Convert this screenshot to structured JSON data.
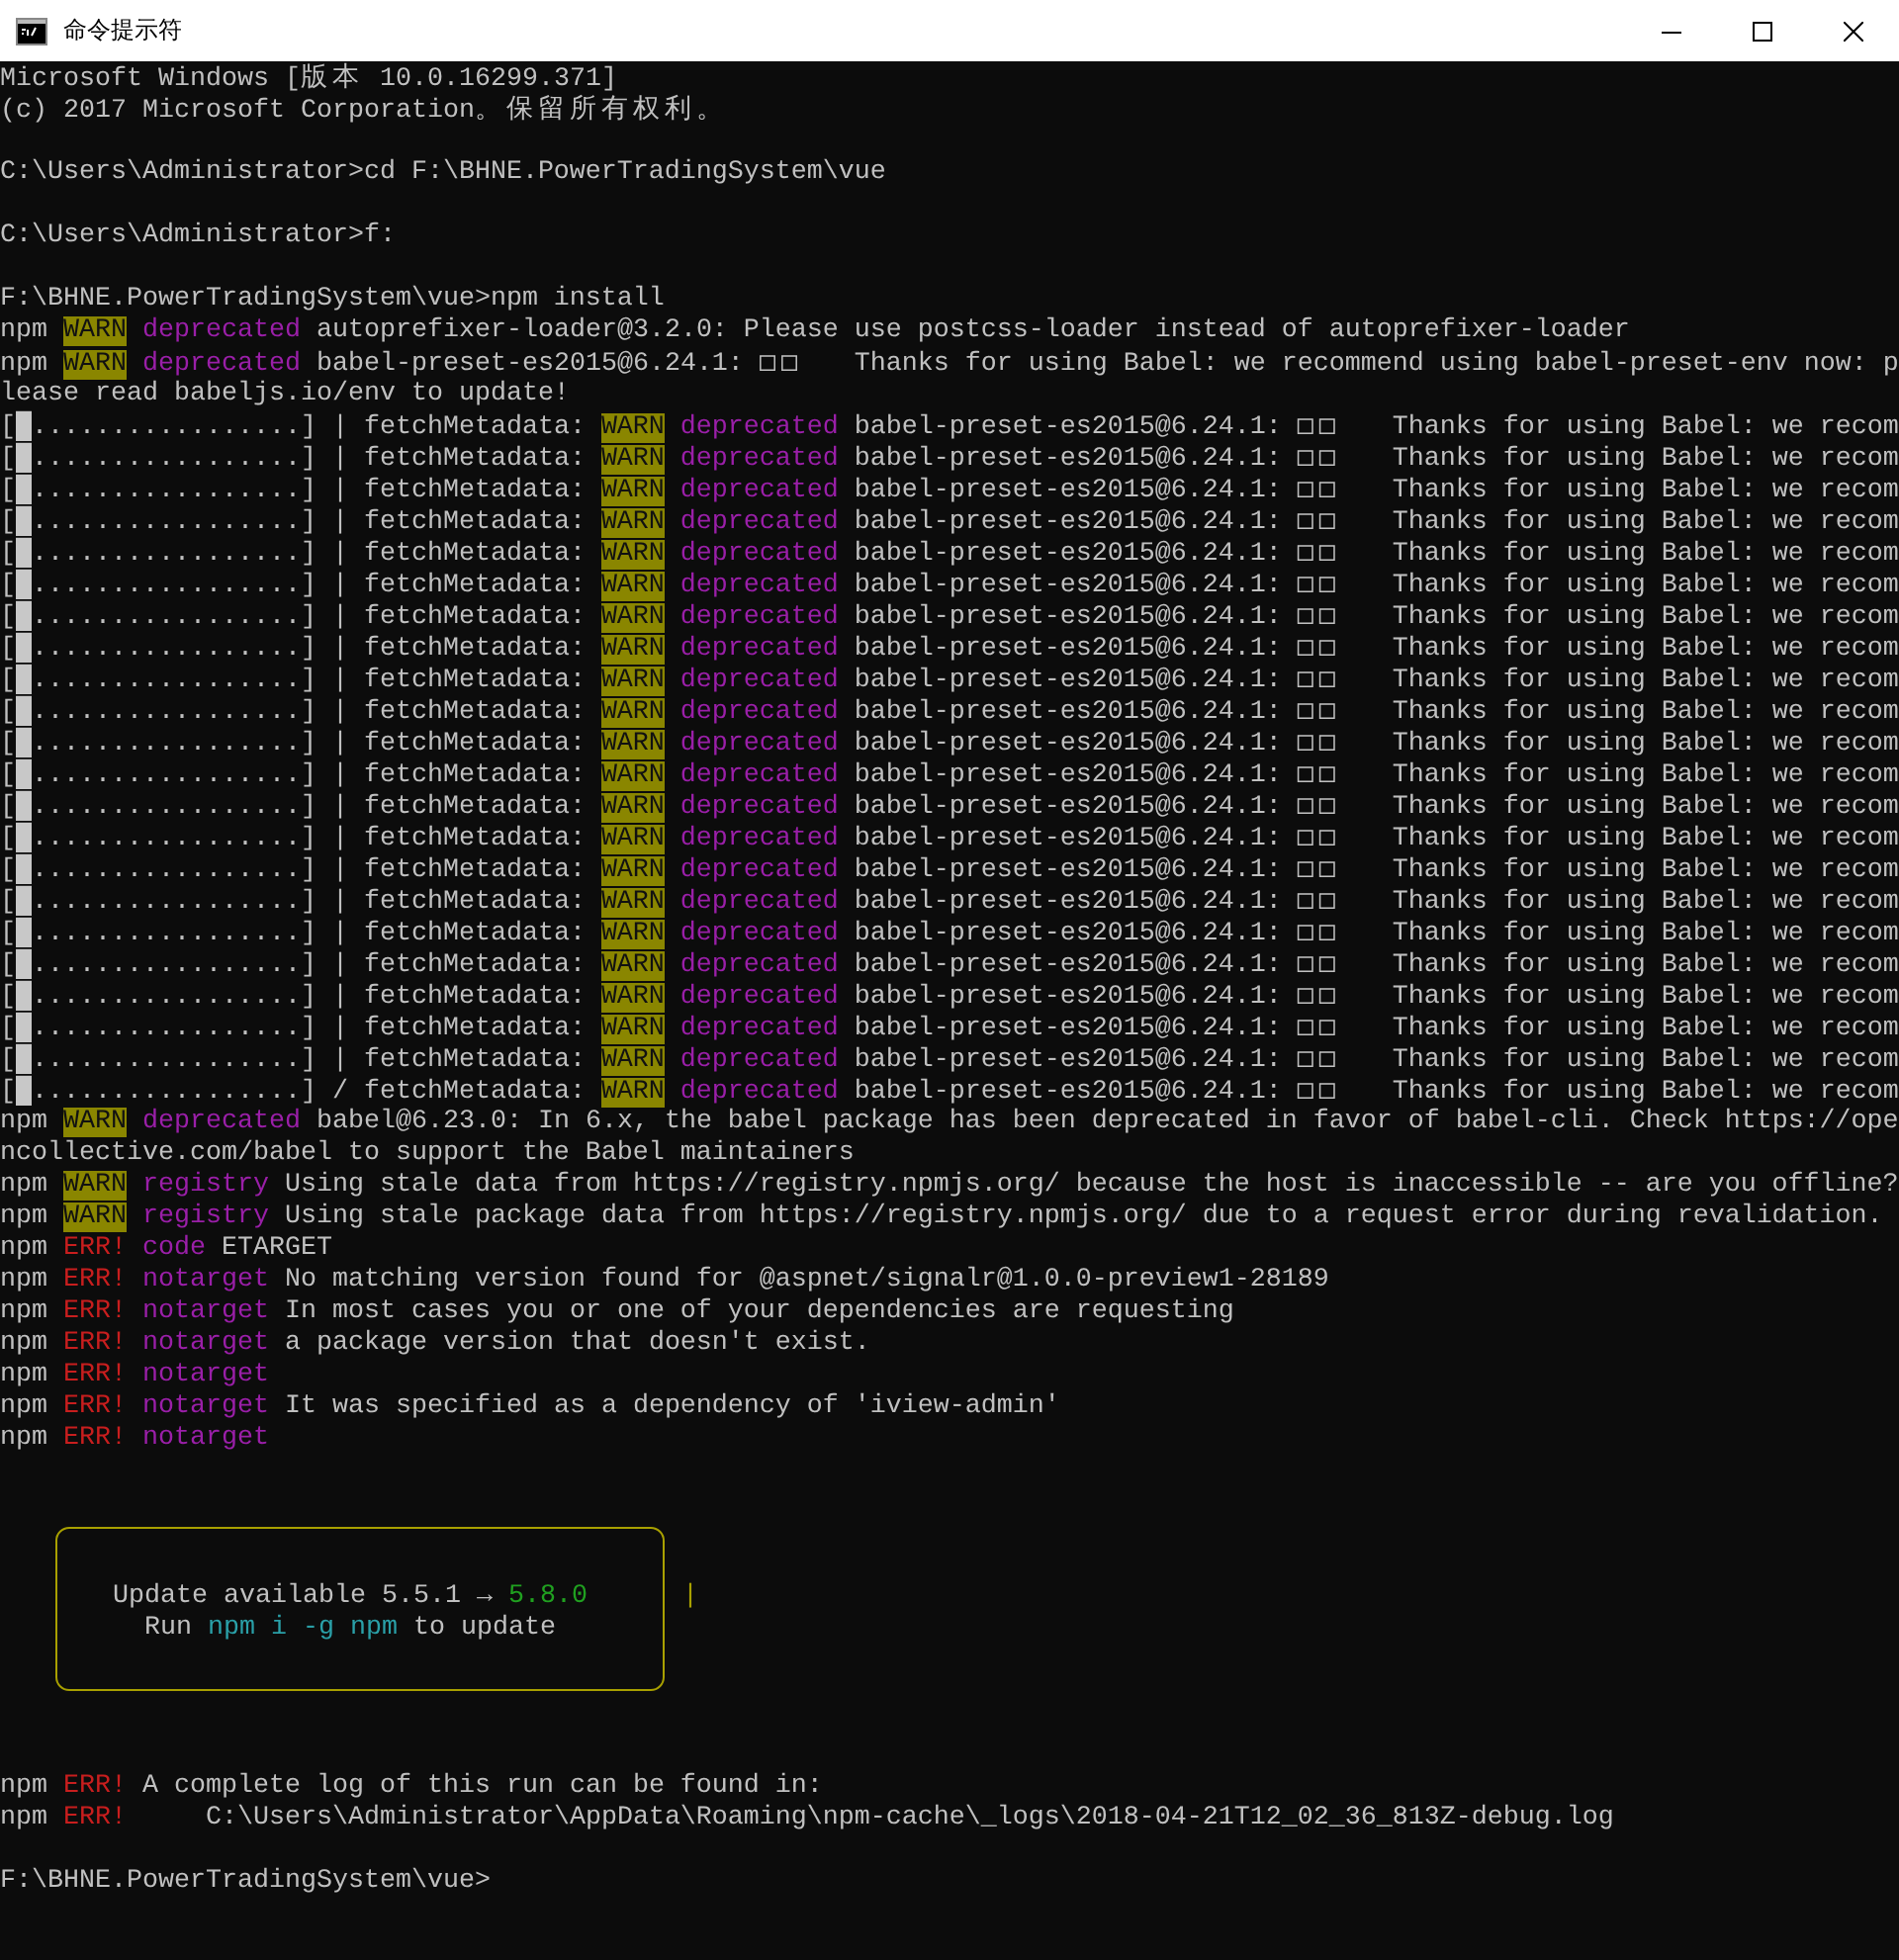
{
  "window": {
    "title": "命令提示符"
  },
  "console": {
    "lines": [
      {
        "kind": "text",
        "segments": [
          {
            "kind": "plain",
            "text": "Microsoft Windows ["
          },
          {
            "kind": "wide",
            "text": "版本"
          },
          {
            "kind": "plain",
            "text": " 10.0.16299.371]"
          }
        ]
      },
      {
        "kind": "text",
        "segments": [
          {
            "kind": "plain",
            "text": "(c) 2017 Microsoft Corporation"
          },
          {
            "kind": "wide",
            "text": "。保留所有权利。"
          }
        ]
      },
      {
        "kind": "blank"
      },
      {
        "kind": "text",
        "segments": [
          {
            "kind": "plain",
            "text": "C:\\Users\\Administrator>cd F:\\BHNE.PowerTradingSystem\\vue"
          }
        ]
      },
      {
        "kind": "blank"
      },
      {
        "kind": "text",
        "segments": [
          {
            "kind": "plain",
            "text": "C:\\Users\\Administrator>f:"
          }
        ]
      },
      {
        "kind": "blank"
      },
      {
        "kind": "text",
        "segments": [
          {
            "kind": "plain",
            "text": "F:\\BHNE.PowerTradingSystem\\vue>npm install"
          }
        ]
      },
      {
        "kind": "text",
        "segments": [
          {
            "kind": "plain",
            "text": "npm "
          },
          {
            "kind": "warn",
            "text": "WARN"
          },
          {
            "kind": "magenta",
            "text": " deprecated"
          },
          {
            "kind": "plain",
            "text": " autoprefixer-loader@3.2.0: Please use postcss-loader instead of autoprefixer-loader"
          }
        ]
      },
      {
        "kind": "text",
        "segments": [
          {
            "kind": "plain",
            "text": "npm "
          },
          {
            "kind": "warn",
            "text": "WARN"
          },
          {
            "kind": "magenta",
            "text": " deprecated"
          },
          {
            "kind": "plain",
            "text": " babel-preset-es2015@6.24.1: "
          },
          {
            "kind": "wide",
            "text": "□□"
          },
          {
            "kind": "plain",
            "text": "  Thanks for using Babel: we recommend using babel-preset-env now: p"
          }
        ]
      },
      {
        "kind": "text",
        "segments": [
          {
            "kind": "plain",
            "text": "lease read babeljs.io/env to update!"
          }
        ]
      },
      {
        "kind": "text",
        "segments": [
          {
            "kind": "plain",
            "text": "["
          },
          {
            "kind": "block",
            "text": "█"
          },
          {
            "kind": "plain",
            "text": ".................] | fetchMetadata: "
          },
          {
            "kind": "warn",
            "text": "WARN"
          },
          {
            "kind": "magenta",
            "text": " deprecated"
          },
          {
            "kind": "plain",
            "text": " babel-preset-es2015@6.24.1: "
          },
          {
            "kind": "wide",
            "text": "□□"
          },
          {
            "kind": "plain",
            "text": "  Thanks for using Babel: we recom"
          }
        ]
      },
      {
        "kind": "text",
        "segments": [
          {
            "kind": "plain",
            "text": "["
          },
          {
            "kind": "block",
            "text": "█"
          },
          {
            "kind": "plain",
            "text": ".................] | fetchMetadata: "
          },
          {
            "kind": "warn",
            "text": "WARN"
          },
          {
            "kind": "magenta",
            "text": " deprecated"
          },
          {
            "kind": "plain",
            "text": " babel-preset-es2015@6.24.1: "
          },
          {
            "kind": "wide",
            "text": "□□"
          },
          {
            "kind": "plain",
            "text": "  Thanks for using Babel: we recom"
          }
        ]
      },
      {
        "kind": "text",
        "segments": [
          {
            "kind": "plain",
            "text": "["
          },
          {
            "kind": "block",
            "text": "█"
          },
          {
            "kind": "plain",
            "text": ".................] | fetchMetadata: "
          },
          {
            "kind": "warn",
            "text": "WARN"
          },
          {
            "kind": "magenta",
            "text": " deprecated"
          },
          {
            "kind": "plain",
            "text": " babel-preset-es2015@6.24.1: "
          },
          {
            "kind": "wide",
            "text": "□□"
          },
          {
            "kind": "plain",
            "text": "  Thanks for using Babel: we recom"
          }
        ]
      },
      {
        "kind": "text",
        "segments": [
          {
            "kind": "plain",
            "text": "["
          },
          {
            "kind": "block",
            "text": "█"
          },
          {
            "kind": "plain",
            "text": ".................] | fetchMetadata: "
          },
          {
            "kind": "warn",
            "text": "WARN"
          },
          {
            "kind": "magenta",
            "text": " deprecated"
          },
          {
            "kind": "plain",
            "text": " babel-preset-es2015@6.24.1: "
          },
          {
            "kind": "wide",
            "text": "□□"
          },
          {
            "kind": "plain",
            "text": "  Thanks for using Babel: we recom"
          }
        ]
      },
      {
        "kind": "text",
        "segments": [
          {
            "kind": "plain",
            "text": "["
          },
          {
            "kind": "block",
            "text": "█"
          },
          {
            "kind": "plain",
            "text": ".................] | fetchMetadata: "
          },
          {
            "kind": "warn",
            "text": "WARN"
          },
          {
            "kind": "magenta",
            "text": " deprecated"
          },
          {
            "kind": "plain",
            "text": " babel-preset-es2015@6.24.1: "
          },
          {
            "kind": "wide",
            "text": "□□"
          },
          {
            "kind": "plain",
            "text": "  Thanks for using Babel: we recom"
          }
        ]
      },
      {
        "kind": "text",
        "segments": [
          {
            "kind": "plain",
            "text": "["
          },
          {
            "kind": "block",
            "text": "█"
          },
          {
            "kind": "plain",
            "text": ".................] | fetchMetadata: "
          },
          {
            "kind": "warn",
            "text": "WARN"
          },
          {
            "kind": "magenta",
            "text": " deprecated"
          },
          {
            "kind": "plain",
            "text": " babel-preset-es2015@6.24.1: "
          },
          {
            "kind": "wide",
            "text": "□□"
          },
          {
            "kind": "plain",
            "text": "  Thanks for using Babel: we recom"
          }
        ]
      },
      {
        "kind": "text",
        "segments": [
          {
            "kind": "plain",
            "text": "["
          },
          {
            "kind": "block",
            "text": "█"
          },
          {
            "kind": "plain",
            "text": ".................] | fetchMetadata: "
          },
          {
            "kind": "warn",
            "text": "WARN"
          },
          {
            "kind": "magenta",
            "text": " deprecated"
          },
          {
            "kind": "plain",
            "text": " babel-preset-es2015@6.24.1: "
          },
          {
            "kind": "wide",
            "text": "□□"
          },
          {
            "kind": "plain",
            "text": "  Thanks for using Babel: we recom"
          }
        ]
      },
      {
        "kind": "text",
        "segments": [
          {
            "kind": "plain",
            "text": "["
          },
          {
            "kind": "block",
            "text": "█"
          },
          {
            "kind": "plain",
            "text": ".................] | fetchMetadata: "
          },
          {
            "kind": "warn",
            "text": "WARN"
          },
          {
            "kind": "magenta",
            "text": " deprecated"
          },
          {
            "kind": "plain",
            "text": " babel-preset-es2015@6.24.1: "
          },
          {
            "kind": "wide",
            "text": "□□"
          },
          {
            "kind": "plain",
            "text": "  Thanks for using Babel: we recom"
          }
        ]
      },
      {
        "kind": "text",
        "segments": [
          {
            "kind": "plain",
            "text": "["
          },
          {
            "kind": "block",
            "text": "█"
          },
          {
            "kind": "plain",
            "text": ".................] | fetchMetadata: "
          },
          {
            "kind": "warn",
            "text": "WARN"
          },
          {
            "kind": "magenta",
            "text": " deprecated"
          },
          {
            "kind": "plain",
            "text": " babel-preset-es2015@6.24.1: "
          },
          {
            "kind": "wide",
            "text": "□□"
          },
          {
            "kind": "plain",
            "text": "  Thanks for using Babel: we recom"
          }
        ]
      },
      {
        "kind": "text",
        "segments": [
          {
            "kind": "plain",
            "text": "["
          },
          {
            "kind": "block",
            "text": "█"
          },
          {
            "kind": "plain",
            "text": ".................] | fetchMetadata: "
          },
          {
            "kind": "warn",
            "text": "WARN"
          },
          {
            "kind": "magenta",
            "text": " deprecated"
          },
          {
            "kind": "plain",
            "text": " babel-preset-es2015@6.24.1: "
          },
          {
            "kind": "wide",
            "text": "□□"
          },
          {
            "kind": "plain",
            "text": "  Thanks for using Babel: we recom"
          }
        ]
      },
      {
        "kind": "text",
        "segments": [
          {
            "kind": "plain",
            "text": "["
          },
          {
            "kind": "block",
            "text": "█"
          },
          {
            "kind": "plain",
            "text": ".................] | fetchMetadata: "
          },
          {
            "kind": "warn",
            "text": "WARN"
          },
          {
            "kind": "magenta",
            "text": " deprecated"
          },
          {
            "kind": "plain",
            "text": " babel-preset-es2015@6.24.1: "
          },
          {
            "kind": "wide",
            "text": "□□"
          },
          {
            "kind": "plain",
            "text": "  Thanks for using Babel: we recom"
          }
        ]
      },
      {
        "kind": "text",
        "segments": [
          {
            "kind": "plain",
            "text": "["
          },
          {
            "kind": "block",
            "text": "█"
          },
          {
            "kind": "plain",
            "text": ".................] | fetchMetadata: "
          },
          {
            "kind": "warn",
            "text": "WARN"
          },
          {
            "kind": "magenta",
            "text": " deprecated"
          },
          {
            "kind": "plain",
            "text": " babel-preset-es2015@6.24.1: "
          },
          {
            "kind": "wide",
            "text": "□□"
          },
          {
            "kind": "plain",
            "text": "  Thanks for using Babel: we recom"
          }
        ]
      },
      {
        "kind": "text",
        "segments": [
          {
            "kind": "plain",
            "text": "["
          },
          {
            "kind": "block",
            "text": "█"
          },
          {
            "kind": "plain",
            "text": ".................] | fetchMetadata: "
          },
          {
            "kind": "warn",
            "text": "WARN"
          },
          {
            "kind": "magenta",
            "text": " deprecated"
          },
          {
            "kind": "plain",
            "text": " babel-preset-es2015@6.24.1: "
          },
          {
            "kind": "wide",
            "text": "□□"
          },
          {
            "kind": "plain",
            "text": "  Thanks for using Babel: we recom"
          }
        ]
      },
      {
        "kind": "text",
        "segments": [
          {
            "kind": "plain",
            "text": "["
          },
          {
            "kind": "block",
            "text": "█"
          },
          {
            "kind": "plain",
            "text": ".................] | fetchMetadata: "
          },
          {
            "kind": "warn",
            "text": "WARN"
          },
          {
            "kind": "magenta",
            "text": " deprecated"
          },
          {
            "kind": "plain",
            "text": " babel-preset-es2015@6.24.1: "
          },
          {
            "kind": "wide",
            "text": "□□"
          },
          {
            "kind": "plain",
            "text": "  Thanks for using Babel: we recom"
          }
        ]
      },
      {
        "kind": "text",
        "segments": [
          {
            "kind": "plain",
            "text": "["
          },
          {
            "kind": "block",
            "text": "█"
          },
          {
            "kind": "plain",
            "text": ".................] | fetchMetadata: "
          },
          {
            "kind": "warn",
            "text": "WARN"
          },
          {
            "kind": "magenta",
            "text": " deprecated"
          },
          {
            "kind": "plain",
            "text": " babel-preset-es2015@6.24.1: "
          },
          {
            "kind": "wide",
            "text": "□□"
          },
          {
            "kind": "plain",
            "text": "  Thanks for using Babel: we recom"
          }
        ]
      },
      {
        "kind": "text",
        "segments": [
          {
            "kind": "plain",
            "text": "["
          },
          {
            "kind": "block",
            "text": "█"
          },
          {
            "kind": "plain",
            "text": ".................] | fetchMetadata: "
          },
          {
            "kind": "warn",
            "text": "WARN"
          },
          {
            "kind": "magenta",
            "text": " deprecated"
          },
          {
            "kind": "plain",
            "text": " babel-preset-es2015@6.24.1: "
          },
          {
            "kind": "wide",
            "text": "□□"
          },
          {
            "kind": "plain",
            "text": "  Thanks for using Babel: we recom"
          }
        ]
      },
      {
        "kind": "text",
        "segments": [
          {
            "kind": "plain",
            "text": "["
          },
          {
            "kind": "block",
            "text": "█"
          },
          {
            "kind": "plain",
            "text": ".................] | fetchMetadata: "
          },
          {
            "kind": "warn",
            "text": "WARN"
          },
          {
            "kind": "magenta",
            "text": " deprecated"
          },
          {
            "kind": "plain",
            "text": " babel-preset-es2015@6.24.1: "
          },
          {
            "kind": "wide",
            "text": "□□"
          },
          {
            "kind": "plain",
            "text": "  Thanks for using Babel: we recom"
          }
        ]
      },
      {
        "kind": "text",
        "segments": [
          {
            "kind": "plain",
            "text": "["
          },
          {
            "kind": "block",
            "text": "█"
          },
          {
            "kind": "plain",
            "text": ".................] | fetchMetadata: "
          },
          {
            "kind": "warn",
            "text": "WARN"
          },
          {
            "kind": "magenta",
            "text": " deprecated"
          },
          {
            "kind": "plain",
            "text": " babel-preset-es2015@6.24.1: "
          },
          {
            "kind": "wide",
            "text": "□□"
          },
          {
            "kind": "plain",
            "text": "  Thanks for using Babel: we recom"
          }
        ]
      },
      {
        "kind": "text",
        "segments": [
          {
            "kind": "plain",
            "text": "["
          },
          {
            "kind": "block",
            "text": "█"
          },
          {
            "kind": "plain",
            "text": ".................] | fetchMetadata: "
          },
          {
            "kind": "warn",
            "text": "WARN"
          },
          {
            "kind": "magenta",
            "text": " deprecated"
          },
          {
            "kind": "plain",
            "text": " babel-preset-es2015@6.24.1: "
          },
          {
            "kind": "wide",
            "text": "□□"
          },
          {
            "kind": "plain",
            "text": "  Thanks for using Babel: we recom"
          }
        ]
      },
      {
        "kind": "text",
        "segments": [
          {
            "kind": "plain",
            "text": "["
          },
          {
            "kind": "block",
            "text": "█"
          },
          {
            "kind": "plain",
            "text": ".................] | fetchMetadata: "
          },
          {
            "kind": "warn",
            "text": "WARN"
          },
          {
            "kind": "magenta",
            "text": " deprecated"
          },
          {
            "kind": "plain",
            "text": " babel-preset-es2015@6.24.1: "
          },
          {
            "kind": "wide",
            "text": "□□"
          },
          {
            "kind": "plain",
            "text": "  Thanks for using Babel: we recom"
          }
        ]
      },
      {
        "kind": "text",
        "segments": [
          {
            "kind": "plain",
            "text": "["
          },
          {
            "kind": "block",
            "text": "█"
          },
          {
            "kind": "plain",
            "text": ".................] | fetchMetadata: "
          },
          {
            "kind": "warn",
            "text": "WARN"
          },
          {
            "kind": "magenta",
            "text": " deprecated"
          },
          {
            "kind": "plain",
            "text": " babel-preset-es2015@6.24.1: "
          },
          {
            "kind": "wide",
            "text": "□□"
          },
          {
            "kind": "plain",
            "text": "  Thanks for using Babel: we recom"
          }
        ]
      },
      {
        "kind": "text",
        "segments": [
          {
            "kind": "plain",
            "text": "["
          },
          {
            "kind": "block",
            "text": "█"
          },
          {
            "kind": "plain",
            "text": ".................] / fetchMetadata: "
          },
          {
            "kind": "warn",
            "text": "WARN"
          },
          {
            "kind": "magenta",
            "text": " deprecated"
          },
          {
            "kind": "plain",
            "text": " babel-preset-es2015@6.24.1: "
          },
          {
            "kind": "wide",
            "text": "□□"
          },
          {
            "kind": "plain",
            "text": "  Thanks for using Babel: we recom"
          }
        ]
      },
      {
        "kind": "text",
        "segments": [
          {
            "kind": "plain",
            "text": "npm "
          },
          {
            "kind": "warn",
            "text": "WARN"
          },
          {
            "kind": "magenta",
            "text": " deprecated"
          },
          {
            "kind": "plain",
            "text": " babel@6.23.0: In 6.x, the babel package has been deprecated in favor of babel-cli. Check https://ope"
          }
        ]
      },
      {
        "kind": "text",
        "segments": [
          {
            "kind": "plain",
            "text": "ncollective.com/babel to support the Babel maintainers"
          }
        ]
      },
      {
        "kind": "text",
        "segments": [
          {
            "kind": "plain",
            "text": "npm "
          },
          {
            "kind": "warn",
            "text": "WARN"
          },
          {
            "kind": "magenta",
            "text": " registry"
          },
          {
            "kind": "plain",
            "text": " Using stale data from https://registry.npmjs.org/ because the host is inaccessible -- are you offline?"
          }
        ]
      },
      {
        "kind": "text",
        "segments": [
          {
            "kind": "plain",
            "text": "npm "
          },
          {
            "kind": "warn",
            "text": "WARN"
          },
          {
            "kind": "magenta",
            "text": " registry"
          },
          {
            "kind": "plain",
            "text": " Using stale package data from https://registry.npmjs.org/ due to a request error during revalidation."
          }
        ]
      },
      {
        "kind": "text",
        "segments": [
          {
            "kind": "plain",
            "text": "npm "
          },
          {
            "kind": "err",
            "text": "ERR!"
          },
          {
            "kind": "magenta",
            "text": " code"
          },
          {
            "kind": "plain",
            "text": " ETARGET"
          }
        ]
      },
      {
        "kind": "text",
        "segments": [
          {
            "kind": "plain",
            "text": "npm "
          },
          {
            "kind": "err",
            "text": "ERR!"
          },
          {
            "kind": "magenta",
            "text": " notarget"
          },
          {
            "kind": "plain",
            "text": " No matching version found for @aspnet/signalr@1.0.0-preview1-28189"
          }
        ]
      },
      {
        "kind": "text",
        "segments": [
          {
            "kind": "plain",
            "text": "npm "
          },
          {
            "kind": "err",
            "text": "ERR!"
          },
          {
            "kind": "magenta",
            "text": " notarget"
          },
          {
            "kind": "plain",
            "text": " In most cases you or one of your dependencies are requesting"
          }
        ]
      },
      {
        "kind": "text",
        "segments": [
          {
            "kind": "plain",
            "text": "npm "
          },
          {
            "kind": "err",
            "text": "ERR!"
          },
          {
            "kind": "magenta",
            "text": " notarget"
          },
          {
            "kind": "plain",
            "text": " a package version that doesn't exist."
          }
        ]
      },
      {
        "kind": "text",
        "segments": [
          {
            "kind": "plain",
            "text": "npm "
          },
          {
            "kind": "err",
            "text": "ERR!"
          },
          {
            "kind": "magenta",
            "text": " notarget"
          }
        ]
      },
      {
        "kind": "text",
        "segments": [
          {
            "kind": "plain",
            "text": "npm "
          },
          {
            "kind": "err",
            "text": "ERR!"
          },
          {
            "kind": "magenta",
            "text": " notarget"
          },
          {
            "kind": "plain",
            "text": " It was specified as a dependency of 'iview-admin'"
          }
        ]
      },
      {
        "kind": "text",
        "segments": [
          {
            "kind": "plain",
            "text": "npm "
          },
          {
            "kind": "err",
            "text": "ERR!"
          },
          {
            "kind": "magenta",
            "text": " notarget"
          }
        ]
      },
      {
        "kind": "blank"
      },
      {
        "kind": "blank"
      },
      {
        "kind": "box",
        "lines": [
          {
            "segments": [
              {
                "kind": "plain",
                "text": "Update available 5.5.1 → "
              },
              {
                "kind": "green",
                "text": "5.8.0"
              },
              {
                "kind": "border",
                "text": "      |"
              }
            ]
          },
          {
            "segments": [
              {
                "kind": "plain",
                "text": "  Run "
              },
              {
                "kind": "cyan",
                "text": "npm i -g npm"
              },
              {
                "kind": "plain",
                "text": " to update"
              }
            ]
          }
        ]
      },
      {
        "kind": "blank"
      },
      {
        "kind": "blank"
      },
      {
        "kind": "text",
        "segments": [
          {
            "kind": "plain",
            "text": "npm "
          },
          {
            "kind": "err",
            "text": "ERR!"
          },
          {
            "kind": "plain",
            "text": " A complete log of this run can be found in:"
          }
        ]
      },
      {
        "kind": "text",
        "segments": [
          {
            "kind": "plain",
            "text": "npm "
          },
          {
            "kind": "err",
            "text": "ERR!"
          },
          {
            "kind": "plain",
            "text": "     C:\\Users\\Administrator\\AppData\\Roaming\\npm-cache\\_logs\\2018-04-21T12_02_36_813Z-debug.log"
          }
        ]
      },
      {
        "kind": "blank"
      },
      {
        "kind": "text",
        "segments": [
          {
            "kind": "plain",
            "text": "F:\\BHNE.PowerTradingSystem\\vue>"
          }
        ]
      }
    ]
  }
}
